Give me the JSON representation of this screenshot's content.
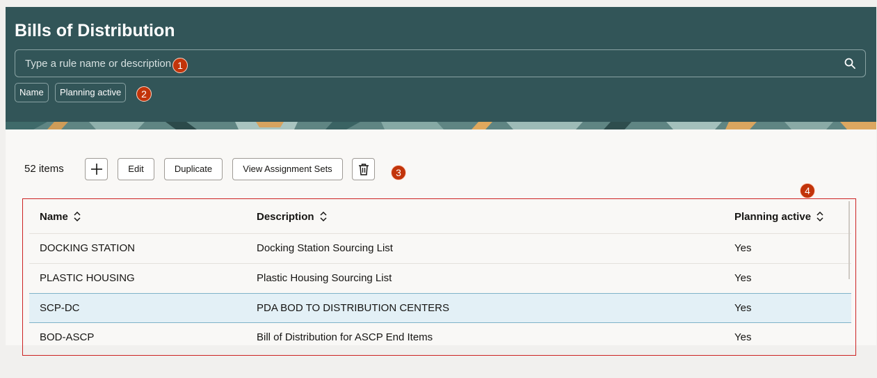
{
  "page": {
    "title": "Bills of Distribution",
    "search_placeholder": "Type a rule name or description"
  },
  "filters": [
    {
      "label": "Name"
    },
    {
      "label": "Planning active"
    }
  ],
  "callouts": [
    "1",
    "2",
    "3",
    "4"
  ],
  "toolbar": {
    "count": "52 items",
    "edit": "Edit",
    "duplicate": "Duplicate",
    "view_sets": "View Assignment Sets"
  },
  "table": {
    "columns": [
      "Name",
      "Description",
      "Planning active"
    ],
    "rows": [
      {
        "name": "DOCKING STATION",
        "description": "Docking Station Sourcing List",
        "planning_active": "Yes"
      },
      {
        "name": "PLASTIC HOUSING",
        "description": "Plastic Housing Sourcing List",
        "planning_active": "Yes"
      },
      {
        "name": "SCP-DC",
        "description": "PDA BOD TO DISTRIBUTION CENTERS",
        "planning_active": "Yes"
      },
      {
        "name": "BOD-ASCP",
        "description": "Bill of Distribution for ASCP End Items",
        "planning_active": "Yes"
      }
    ]
  },
  "colors": {
    "header_bg": "#325558",
    "selected_row": "#e3f0f6",
    "callout": "#c2340a",
    "highlight_border": "#cc2222"
  }
}
